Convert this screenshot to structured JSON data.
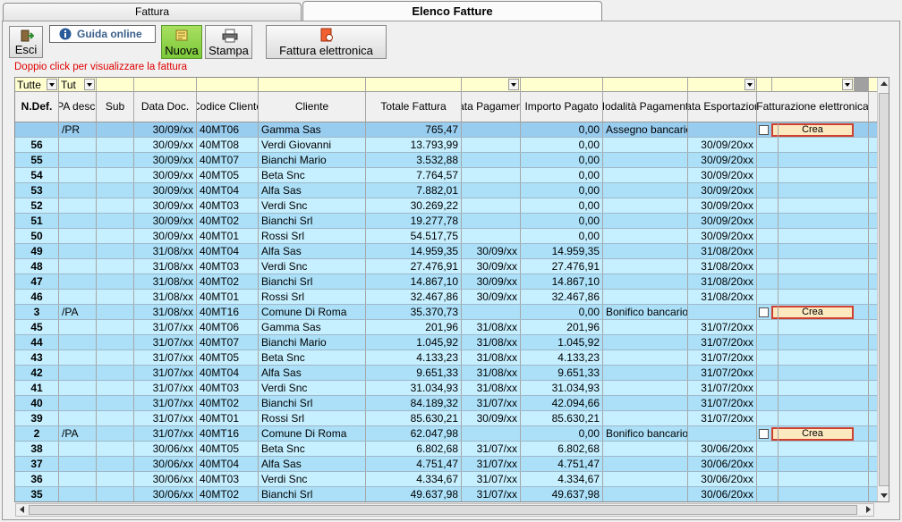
{
  "tabs": [
    {
      "label": "Fattura",
      "active": false
    },
    {
      "label": "Elenco Fatture",
      "active": true
    }
  ],
  "toolbar": {
    "esci_label": "Esci",
    "guida_label": "Guida online",
    "nuova_label": "Nuova",
    "stampa_label": "Stampa",
    "fatel_label": "Fattura elettronica"
  },
  "hint": "Doppio click per visualizzare la fattura",
  "filters": {
    "ndef": "Tutte",
    "pa": "Tut"
  },
  "columns": [
    "N.Def.",
    "PA desc.",
    "Sub",
    "Data Doc.",
    "Codice Cliente",
    "Cliente",
    "Totale Fattura",
    "Data Pagamento",
    "Importo Pagato",
    "Modalità Pagamento",
    "Data Esportazione",
    "Fatturazione elettronica"
  ],
  "crea_label": "Crea",
  "rows": [
    {
      "ndef": "",
      "pa": "/PR",
      "sub": "",
      "data": "30/09/xx",
      "codice": "40MT06",
      "cliente": "Gamma Sas",
      "totale": "765,47",
      "datapag": "",
      "importo": "0,00",
      "modalita": "Assegno bancario",
      "dataexp": "",
      "crea": true
    },
    {
      "ndef": "56",
      "pa": "",
      "sub": "",
      "data": "30/09/xx",
      "codice": "40MT08",
      "cliente": "Verdi Giovanni",
      "totale": "13.793,99",
      "datapag": "",
      "importo": "0,00",
      "modalita": "",
      "dataexp": "30/09/20xx",
      "crea": false
    },
    {
      "ndef": "55",
      "pa": "",
      "sub": "",
      "data": "30/09/xx",
      "codice": "40MT07",
      "cliente": "Bianchi Mario",
      "totale": "3.532,88",
      "datapag": "",
      "importo": "0,00",
      "modalita": "",
      "dataexp": "30/09/20xx",
      "crea": false
    },
    {
      "ndef": "54",
      "pa": "",
      "sub": "",
      "data": "30/09/xx",
      "codice": "40MT05",
      "cliente": "Beta Snc",
      "totale": "7.764,57",
      "datapag": "",
      "importo": "0,00",
      "modalita": "",
      "dataexp": "30/09/20xx",
      "crea": false
    },
    {
      "ndef": "53",
      "pa": "",
      "sub": "",
      "data": "30/09/xx",
      "codice": "40MT04",
      "cliente": "Alfa Sas",
      "totale": "7.882,01",
      "datapag": "",
      "importo": "0,00",
      "modalita": "",
      "dataexp": "30/09/20xx",
      "crea": false
    },
    {
      "ndef": "52",
      "pa": "",
      "sub": "",
      "data": "30/09/xx",
      "codice": "40MT03",
      "cliente": "Verdi Snc",
      "totale": "30.269,22",
      "datapag": "",
      "importo": "0,00",
      "modalita": "",
      "dataexp": "30/09/20xx",
      "crea": false
    },
    {
      "ndef": "51",
      "pa": "",
      "sub": "",
      "data": "30/09/xx",
      "codice": "40MT02",
      "cliente": "Bianchi Srl",
      "totale": "19.277,78",
      "datapag": "",
      "importo": "0,00",
      "modalita": "",
      "dataexp": "30/09/20xx",
      "crea": false
    },
    {
      "ndef": "50",
      "pa": "",
      "sub": "",
      "data": "30/09/xx",
      "codice": "40MT01",
      "cliente": "Rossi Srl",
      "totale": "54.517,75",
      "datapag": "",
      "importo": "0,00",
      "modalita": "",
      "dataexp": "30/09/20xx",
      "crea": false
    },
    {
      "ndef": "49",
      "pa": "",
      "sub": "",
      "data": "31/08/xx",
      "codice": "40MT04",
      "cliente": "Alfa Sas",
      "totale": "14.959,35",
      "datapag": "30/09/xx",
      "importo": "14.959,35",
      "modalita": "",
      "dataexp": "31/08/20xx",
      "crea": false
    },
    {
      "ndef": "48",
      "pa": "",
      "sub": "",
      "data": "31/08/xx",
      "codice": "40MT03",
      "cliente": "Verdi Snc",
      "totale": "27.476,91",
      "datapag": "30/09/xx",
      "importo": "27.476,91",
      "modalita": "",
      "dataexp": "31/08/20xx",
      "crea": false
    },
    {
      "ndef": "47",
      "pa": "",
      "sub": "",
      "data": "31/08/xx",
      "codice": "40MT02",
      "cliente": "Bianchi Srl",
      "totale": "14.867,10",
      "datapag": "30/09/xx",
      "importo": "14.867,10",
      "modalita": "",
      "dataexp": "31/08/20xx",
      "crea": false
    },
    {
      "ndef": "46",
      "pa": "",
      "sub": "",
      "data": "31/08/xx",
      "codice": "40MT01",
      "cliente": "Rossi Srl",
      "totale": "32.467,86",
      "datapag": "30/09/xx",
      "importo": "32.467,86",
      "modalita": "",
      "dataexp": "31/08/20xx",
      "crea": false
    },
    {
      "ndef": "3",
      "pa": "/PA",
      "sub": "",
      "data": "31/08/xx",
      "codice": "40MT16",
      "cliente": "Comune Di Roma",
      "totale": "35.370,73",
      "datapag": "",
      "importo": "0,00",
      "modalita": "Bonifico bancario",
      "dataexp": "",
      "crea": true
    },
    {
      "ndef": "45",
      "pa": "",
      "sub": "",
      "data": "31/07/xx",
      "codice": "40MT06",
      "cliente": "Gamma Sas",
      "totale": "201,96",
      "datapag": "31/08/xx",
      "importo": "201,96",
      "modalita": "",
      "dataexp": "31/07/20xx",
      "crea": false
    },
    {
      "ndef": "44",
      "pa": "",
      "sub": "",
      "data": "31/07/xx",
      "codice": "40MT07",
      "cliente": "Bianchi Mario",
      "totale": "1.045,92",
      "datapag": "31/08/xx",
      "importo": "1.045,92",
      "modalita": "",
      "dataexp": "31/07/20xx",
      "crea": false
    },
    {
      "ndef": "43",
      "pa": "",
      "sub": "",
      "data": "31/07/xx",
      "codice": "40MT05",
      "cliente": "Beta Snc",
      "totale": "4.133,23",
      "datapag": "31/08/xx",
      "importo": "4.133,23",
      "modalita": "",
      "dataexp": "31/07/20xx",
      "crea": false
    },
    {
      "ndef": "42",
      "pa": "",
      "sub": "",
      "data": "31/07/xx",
      "codice": "40MT04",
      "cliente": "Alfa Sas",
      "totale": "9.651,33",
      "datapag": "31/08/xx",
      "importo": "9.651,33",
      "modalita": "",
      "dataexp": "31/07/20xx",
      "crea": false
    },
    {
      "ndef": "41",
      "pa": "",
      "sub": "",
      "data": "31/07/xx",
      "codice": "40MT03",
      "cliente": "Verdi Snc",
      "totale": "31.034,93",
      "datapag": "31/08/xx",
      "importo": "31.034,93",
      "modalita": "",
      "dataexp": "31/07/20xx",
      "crea": false
    },
    {
      "ndef": "40",
      "pa": "",
      "sub": "",
      "data": "31/07/xx",
      "codice": "40MT02",
      "cliente": "Bianchi Srl",
      "totale": "84.189,32",
      "datapag": "31/07/xx",
      "importo": "42.094,66",
      "modalita": "",
      "dataexp": "31/07/20xx",
      "crea": false
    },
    {
      "ndef": "39",
      "pa": "",
      "sub": "",
      "data": "31/07/xx",
      "codice": "40MT01",
      "cliente": "Rossi Srl",
      "totale": "85.630,21",
      "datapag": "30/09/xx",
      "importo": "85.630,21",
      "modalita": "",
      "dataexp": "31/07/20xx",
      "crea": false
    },
    {
      "ndef": "2",
      "pa": "/PA",
      "sub": "",
      "data": "31/07/xx",
      "codice": "40MT16",
      "cliente": "Comune Di Roma",
      "totale": "62.047,98",
      "datapag": "",
      "importo": "0,00",
      "modalita": "Bonifico bancario",
      "dataexp": "",
      "crea": true
    },
    {
      "ndef": "38",
      "pa": "",
      "sub": "",
      "data": "30/06/xx",
      "codice": "40MT05",
      "cliente": "Beta Snc",
      "totale": "6.802,68",
      "datapag": "31/07/xx",
      "importo": "6.802,68",
      "modalita": "",
      "dataexp": "30/06/20xx",
      "crea": false
    },
    {
      "ndef": "37",
      "pa": "",
      "sub": "",
      "data": "30/06/xx",
      "codice": "40MT04",
      "cliente": "Alfa Sas",
      "totale": "4.751,47",
      "datapag": "31/07/xx",
      "importo": "4.751,47",
      "modalita": "",
      "dataexp": "30/06/20xx",
      "crea": false
    },
    {
      "ndef": "36",
      "pa": "",
      "sub": "",
      "data": "30/06/xx",
      "codice": "40MT03",
      "cliente": "Verdi Snc",
      "totale": "4.334,67",
      "datapag": "31/07/xx",
      "importo": "4.334,67",
      "modalita": "",
      "dataexp": "30/06/20xx",
      "crea": false
    },
    {
      "ndef": "35",
      "pa": "",
      "sub": "",
      "data": "30/06/xx",
      "codice": "40MT02",
      "cliente": "Bianchi Srl",
      "totale": "49.637,98",
      "datapag": "31/07/xx",
      "importo": "49.637,98",
      "modalita": "",
      "dataexp": "30/06/20xx",
      "crea": false
    }
  ],
  "colors": {
    "row_light": "#c6efff",
    "row_dark": "#abe0f8",
    "filter_bg": "#ffffd0",
    "hint": "#e00000",
    "crea_border": "#d04030"
  }
}
